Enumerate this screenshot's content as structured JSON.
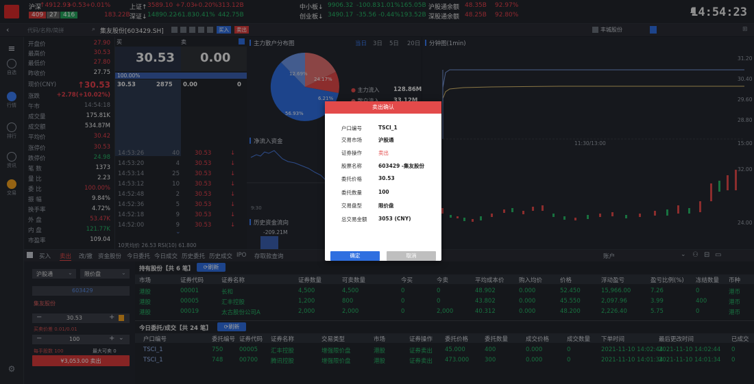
{
  "ticker": {
    "sh_name": "沪深",
    "sh_val": "↑4912.93",
    "sh_chg": "+0.53",
    "sh_pct": "+0.01%",
    "sh_up": "409",
    "sh_flat": "27",
    "sh_down": "416",
    "szz_name": "上证↑",
    "szz_val": "3589.10",
    "szz_chg": "+7.03",
    "szz_pct": "+0.20%",
    "szz_amt": "313.12B",
    "szz_amt2": "183.22B",
    "szc_name": "深证↓",
    "szc_val": "14890.22",
    "szc_chg": "-61.83",
    "szc_pct": "-0.41%",
    "szc_amt": "442.75B",
    "zx_name": "中小板↓",
    "zx_val": "9906.32",
    "zx_chg": "-100.83",
    "zx_pct": "-1.01%",
    "zx_amt": "165.05B",
    "cy_name": "创业板↓",
    "cy_val": "3490.17",
    "cy_chg": "-35.56",
    "cy_pct": "-0.44%",
    "cy_amt": "193.52B",
    "hgt_name": "沪股通余额",
    "hgt_val": "48.35B",
    "hgt_pct": "92.97%",
    "sgt_name": "深股通余额",
    "sgt_val": "48.25B",
    "sgt_pct": "92.80%",
    "clock": "14:54:23"
  },
  "search": {
    "placeholder": "代码/名称/简拼",
    "stock": "集友股份[603429.SH]",
    "tag1": "买入",
    "tag2": "卖出",
    "right_label": "丰城股份"
  },
  "sidebar": [
    {
      "label": "自选"
    },
    {
      "label": "行情"
    },
    {
      "label": "排行"
    },
    {
      "label": "资讯"
    },
    {
      "label": "交易"
    }
  ],
  "stats": [
    {
      "k": "开盘价",
      "v": "27.90",
      "c": "red"
    },
    {
      "k": "最高价",
      "v": "30.53",
      "c": "red"
    },
    {
      "k": "最低价",
      "v": "27.80",
      "c": "red"
    },
    {
      "k": "昨收价",
      "v": "27.75",
      "c": "white"
    },
    {
      "k": "现价(CNY)",
      "v": "↑30.53",
      "c": "red"
    },
    {
      "k": "涨跌",
      "v": "+2.78(+10.02%)",
      "c": "red"
    },
    {
      "k": "午市",
      "v": "14:54:18",
      "c": "dim"
    },
    {
      "k": "成交量",
      "v": "175.81K",
      "c": "white"
    },
    {
      "k": "成交额",
      "v": "534.87M",
      "c": "white"
    },
    {
      "k": "平均价",
      "v": "30.42",
      "c": "red"
    },
    {
      "k": "涨停价",
      "v": "30.53",
      "c": "red"
    },
    {
      "k": "跌停价",
      "v": "24.98",
      "c": "green"
    },
    {
      "k": "笔 数",
      "v": "1373",
      "c": "white"
    },
    {
      "k": "量 比",
      "v": "2.23",
      "c": "white"
    },
    {
      "k": "委 比",
      "v": "100.00%",
      "c": "red"
    },
    {
      "k": "振 幅",
      "v": "9.84%",
      "c": "white"
    },
    {
      "k": "换手率",
      "v": "4.72%",
      "c": "white"
    },
    {
      "k": "外 盘",
      "v": "53.47K",
      "c": "red"
    },
    {
      "k": "内 盘",
      "v": "121.77K",
      "c": "green"
    },
    {
      "k": "市盈率",
      "v": "109.04",
      "c": "white"
    }
  ],
  "quote": {
    "buy_label": "买",
    "sell_label": "卖",
    "buy_price": "30.53",
    "sell_price": "0.00",
    "ratio": "100.00%",
    "bid_price": "30.53",
    "bid_vol": "2875",
    "ask_price": "0.00",
    "ask_vol": "0",
    "trades": [
      {
        "t": "14:53:26",
        "v": "40",
        "p": "30.53"
      },
      {
        "t": "14:53:20",
        "v": "4",
        "p": "30.53"
      },
      {
        "t": "14:53:14",
        "v": "25",
        "p": "30.53"
      },
      {
        "t": "14:53:12",
        "v": "10",
        "p": "30.53"
      },
      {
        "t": "14:52:48",
        "v": "2",
        "p": "30.53"
      },
      {
        "t": "14:52:36",
        "v": "5",
        "p": "30.53"
      },
      {
        "t": "14:52:18",
        "v": "9",
        "p": "30.53"
      },
      {
        "t": "14:52:00",
        "v": "9",
        "p": "30.53"
      }
    ],
    "footer": "10天均价  26.53  RSI(10)  61.800"
  },
  "mid": {
    "title1": "主力散户分布图",
    "pie_pct1": "12.69%",
    "pie_pct2": "24.17%",
    "pie_pct3": "56.93%",
    "pie_pct4": "6.21%",
    "legend1": "主力流入",
    "legend1_v": "128.86M",
    "legend2": "散户流入",
    "legend2_v": "33.12M",
    "title2": "净流入资金",
    "x_label": "9:30",
    "title3": "历史资金流向",
    "hist_val": "-209.21M"
  },
  "right": {
    "periods": [
      "当日",
      "3日",
      "5日",
      "20日"
    ],
    "title": "分钟图(1min)",
    "axis": [
      "31.20",
      "30.40",
      "29.60",
      "28.80",
      "15:00",
      "32.00",
      "24.00"
    ],
    "time_label": "11:30/13:00"
  },
  "tabs": [
    "买入",
    "卖出",
    "改/撤",
    "资金股份",
    "今日委托",
    "今日成交",
    "历史委托",
    "历史成交",
    "IPO",
    "存取款查询"
  ],
  "account_label": "账户",
  "form": {
    "market": "沪股通",
    "order_type": "限价盘",
    "code": "603429",
    "name": "集友股份",
    "price": "30.53",
    "price_hint": "买卖价差 0.01/0.01",
    "qty": "100",
    "max_buy": "每手股数 100",
    "max_sell": "最大可卖 0",
    "submit": "¥3,053.00 卖出"
  },
  "holdings": {
    "title": "持有股份【共 6 笔】",
    "refresh": "刷新",
    "headers": [
      "市场",
      "证券代码",
      "证券名称",
      "证券数量",
      "可卖数量",
      "今买",
      "今卖",
      "平均成本价",
      "购入均价",
      "价格",
      "浮动盈亏",
      "盈亏比例(%)",
      "冻结数量",
      "币种"
    ],
    "rows": [
      [
        "港股",
        "00001",
        "长和",
        "4,500",
        "4,500",
        "0",
        "0",
        "48.902",
        "0.000",
        "52.450",
        "15,966.00",
        "7.26",
        "0",
        "港币"
      ],
      [
        "港股",
        "00005",
        "汇丰控股",
        "1,200",
        "800",
        "0",
        "0",
        "43.802",
        "0.000",
        "45.550",
        "2,097.96",
        "3.99",
        "400",
        "港币"
      ],
      [
        "港股",
        "00019",
        "太古股份公司A",
        "2,000",
        "2,000",
        "0",
        "2,000",
        "40.312",
        "0.000",
        "48.200",
        "2,226.40",
        "5.75",
        "0",
        "港币"
      ]
    ]
  },
  "orders": {
    "title": "今日委托/成交【共 24 笔】",
    "refresh": "刷新",
    "headers": [
      "户口编号",
      "委托编号",
      "证券代码",
      "证券名称",
      "交易类型",
      "市场",
      "证券操作",
      "委托价格",
      "委托数量",
      "成交价格",
      "成交数量",
      "下单时间",
      "最后更改时间",
      "已成交"
    ],
    "rows": [
      [
        "TSCI_1",
        "750",
        "00005",
        "汇丰控股",
        "增强限价盘",
        "港股",
        "证券卖出",
        "45.000",
        "400",
        "0.000",
        "0",
        "2021-11-10 14:02:44",
        "2021-11-10 14:02:44",
        "0"
      ],
      [
        "TSCI_1",
        "748",
        "00700",
        "腾讯控股",
        "增强限价盘",
        "港股",
        "证券卖出",
        "473.000",
        "300",
        "0.000",
        "0",
        "2021-11-10 14:01:34",
        "2021-11-10 14:01:34",
        "0"
      ]
    ]
  },
  "modal": {
    "title": "卖出确认",
    "rows": [
      {
        "k": "户口编号",
        "v": "TSCI_1"
      },
      {
        "k": "交易市场",
        "v": "沪股通"
      },
      {
        "k": "证券操作",
        "v": "卖出"
      },
      {
        "k": "股票名称",
        "v": "603429 -集友股份"
      },
      {
        "k": "委托价格",
        "v": "30.53"
      },
      {
        "k": "委托数量",
        "v": "100"
      },
      {
        "k": "交易盘型",
        "v": "限价盘"
      },
      {
        "k": "总交易金额",
        "v": "3053 (CNY)"
      }
    ],
    "confirm": "确定",
    "cancel": "取消"
  },
  "colors": {
    "accent": "#2f6fe0",
    "up": "#e8414d",
    "down": "#27b666",
    "modal_head": "#e34a4a"
  }
}
